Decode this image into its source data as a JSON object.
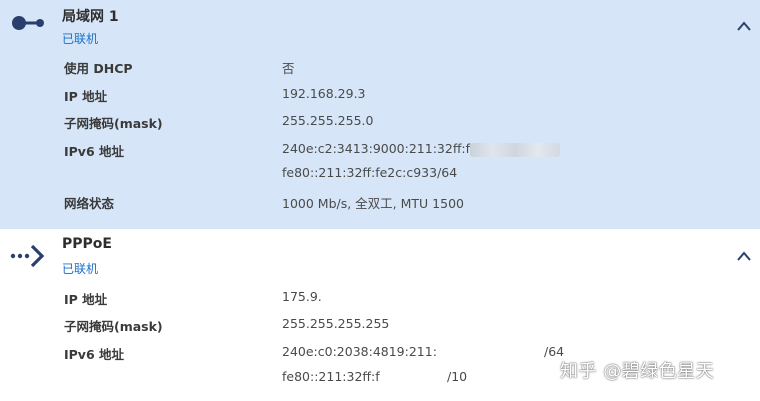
{
  "lan": {
    "title": "局域网 1",
    "status": "已联机",
    "rows": [
      {
        "label": "使用 DHCP",
        "value": "否"
      },
      {
        "label": "IP 地址",
        "value": "192.168.29.3"
      },
      {
        "label": "子网掩码(mask)",
        "value": "255.255.255.0"
      },
      {
        "label": "IPv6 地址",
        "value": "240e:c2:3413:9000:211:32ff:f",
        "value2": "fe80::211:32ff:fe2c:c933/64"
      },
      {
        "label": "网络状态",
        "value": "1000 Mb/s, 全双工, MTU 1500"
      }
    ]
  },
  "pppoe": {
    "title": "PPPoE",
    "status": "已联机",
    "rows": [
      {
        "label": "IP 地址",
        "value": "175.9."
      },
      {
        "label": "子网掩码(mask)",
        "value": "255.255.255.255"
      },
      {
        "label": "IPv6 地址",
        "value": "240e:c0:2038:4819:211:",
        "value_suffix": "/64",
        "value2": "fe80::211:32ff:f",
        "value2_suffix": "/10"
      }
    ]
  },
  "watermark": "知乎 @碧绿色星天",
  "icons": {
    "lan": "network-port-icon",
    "pppoe": "pppoe-arrow-icon",
    "collapse": "chevron-up-icon"
  },
  "colors": {
    "selected_bg": "#d6e6f8",
    "status_blue": "#1a6fc9",
    "icon_blue": "#2a3f6e"
  }
}
